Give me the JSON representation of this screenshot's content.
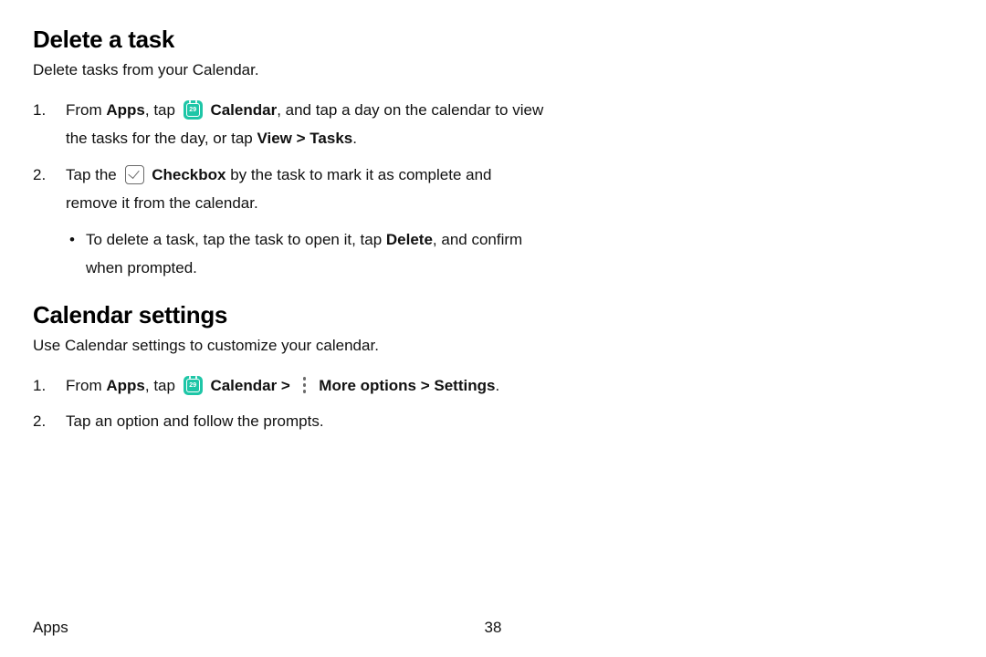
{
  "section1": {
    "heading": "Delete a task",
    "intro": "Delete tasks from your Calendar.",
    "step1": {
      "num": "1.",
      "t1": "From ",
      "apps": "Apps",
      "t2": ", tap ",
      "cal": "Calendar",
      "t3": ", and tap a day on the calendar to view the tasks for the day, or tap ",
      "view": "View",
      "gt": " > ",
      "tasks": "Tasks",
      "t4": "."
    },
    "step2": {
      "num": "2.",
      "t1": "Tap the ",
      "chk": "Checkbox",
      "t2": " by the task to mark it as complete and remove it from the calendar.",
      "bullet_t1": "To delete a task, tap the task to open it, tap ",
      "bullet_del": "Delete",
      "bullet_t2": ", and confirm when prompted."
    }
  },
  "section2": {
    "heading": "Calendar settings",
    "intro": "Use Calendar settings to customize your calendar.",
    "step1": {
      "num": "1.",
      "t1": "From ",
      "apps": "Apps",
      "t2": ", tap ",
      "cal": "Calendar",
      "gt1": " > ",
      "more": "More options",
      "gt2": " > ",
      "settings": "Settings",
      "t3": "."
    },
    "step2": {
      "num": "2.",
      "t1": "Tap an option and follow the prompts."
    }
  },
  "footer": {
    "category": "Apps",
    "page": "38"
  }
}
